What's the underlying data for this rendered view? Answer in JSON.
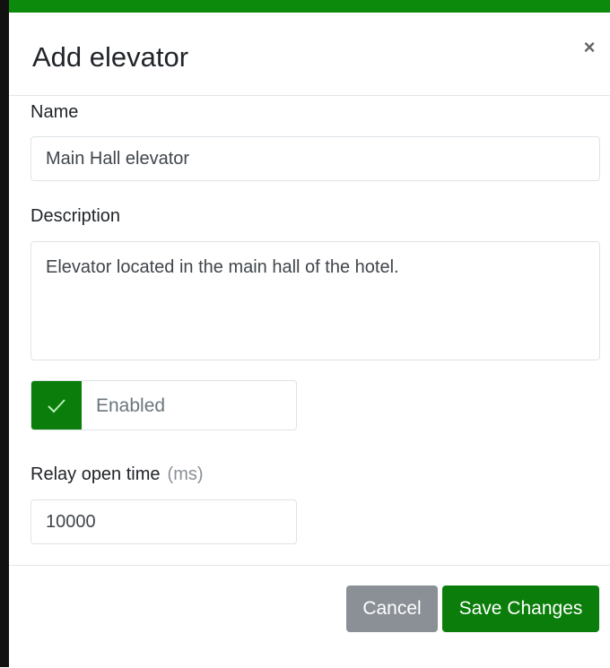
{
  "modal": {
    "title": "Add elevator",
    "close_symbol": "×",
    "name_label": "Name",
    "name_value": "Main Hall elevator",
    "description_label": "Description",
    "description_value": "Elevator located in the main hall of the hotel.",
    "enabled_label": "Enabled",
    "enabled_checked": true,
    "relay_label": "Relay open time",
    "relay_unit": "(ms)",
    "relay_value": "10000",
    "cancel_label": "Cancel",
    "save_label": "Save Changes"
  },
  "colors": {
    "accent": "#0a7d0a",
    "cancel": "#8a9096"
  },
  "icons": {
    "close": "close-icon",
    "check": "check-icon"
  }
}
